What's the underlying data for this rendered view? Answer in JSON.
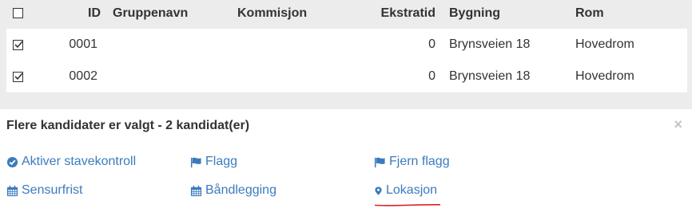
{
  "table": {
    "headers": {
      "id": "ID",
      "group_name": "Gruppenavn",
      "commission": "Kommisjon",
      "extra_time": "Ekstratid",
      "building": "Bygning",
      "room": "Rom"
    },
    "header_checked": false,
    "rows": [
      {
        "checked": true,
        "id": "0001",
        "group_name": "",
        "commission": "",
        "extra_time": "0",
        "building": "Brynsveien 18",
        "room": "Hovedrom"
      },
      {
        "checked": true,
        "id": "0002",
        "group_name": "",
        "commission": "",
        "extra_time": "0",
        "building": "Brynsveien 18",
        "room": "Hovedrom"
      }
    ]
  },
  "panel": {
    "title": "Flere kandidater er valgt - 2 kandidat(er)",
    "close_glyph": "×",
    "actions": [
      {
        "label": "Aktiver stavekontroll",
        "icon": "check-circle-icon"
      },
      {
        "label": "Flagg",
        "icon": "flag-icon"
      },
      {
        "label": "Fjern flagg",
        "icon": "flag-icon"
      },
      {
        "label": "Sensurfrist",
        "icon": "calendar-icon"
      },
      {
        "label": "Båndlegging",
        "icon": "calendar-icon"
      },
      {
        "label": "Lokasjon",
        "icon": "map-marker-icon"
      }
    ]
  },
  "colors": {
    "link": "#3a7bbf",
    "annotation_underline": "#d9232a",
    "background": "#ececec"
  }
}
